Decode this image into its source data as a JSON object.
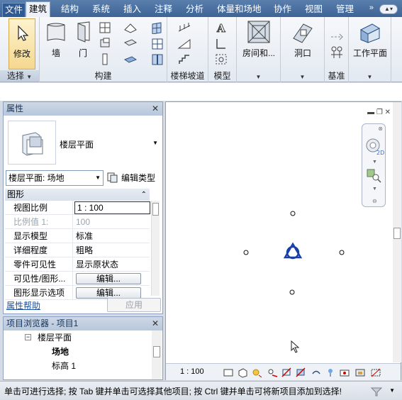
{
  "ribbon_tabs": [
    {
      "label": "文件"
    },
    {
      "label": "建筑"
    },
    {
      "label": "结构"
    },
    {
      "label": "系统"
    },
    {
      "label": "插入"
    },
    {
      "label": "注释"
    },
    {
      "label": "分析"
    },
    {
      "label": "体量和场地"
    },
    {
      "label": "协作"
    },
    {
      "label": "视图"
    },
    {
      "label": "管理"
    }
  ],
  "tab_overflow": "»",
  "ribbon": {
    "select": {
      "button": "修改",
      "panel": "选择"
    },
    "build": {
      "wall": "墙",
      "door": "门",
      "panel": "构建"
    },
    "stairs_panel": "楼梯坡道",
    "model_panel": "模型",
    "room_btn": "房间和...",
    "opening_btn": "洞口",
    "datum_panel": "基准",
    "workplane_btn": "工作平面"
  },
  "properties": {
    "title": "属性",
    "type_name": "楼层平面",
    "instance_selector": "楼层平面: 场地",
    "edit_type": "编辑类型",
    "group": "图形",
    "rows": [
      {
        "key": "视图比例",
        "value": "1 : 100"
      },
      {
        "key": "比例值 1:",
        "value": "100"
      },
      {
        "key": "显示模型",
        "value": "标准"
      },
      {
        "key": "详细程度",
        "value": "粗略"
      },
      {
        "key": "零件可见性",
        "value": "显示原状态"
      },
      {
        "key": "可见性/图形...",
        "value": "编辑..."
      },
      {
        "key": "图形显示选项",
        "value": "编辑..."
      }
    ],
    "help_link": "属性帮助",
    "apply": "应用"
  },
  "browser": {
    "title": "项目浏览器 - 项目1",
    "nodes": [
      {
        "label": "楼层平面"
      },
      {
        "label": "场地"
      },
      {
        "label": "标高 1"
      }
    ]
  },
  "view": {
    "scale": "1 : 100"
  },
  "status": {
    "text": "单击可进行选择; 按 Tab 键并单击可选择其他项目; 按 Ctrl 键并单击可将新项目添加到选择!"
  },
  "colors": {
    "accent": "#3d6496",
    "elevation_marker": "#1b3fa8"
  }
}
